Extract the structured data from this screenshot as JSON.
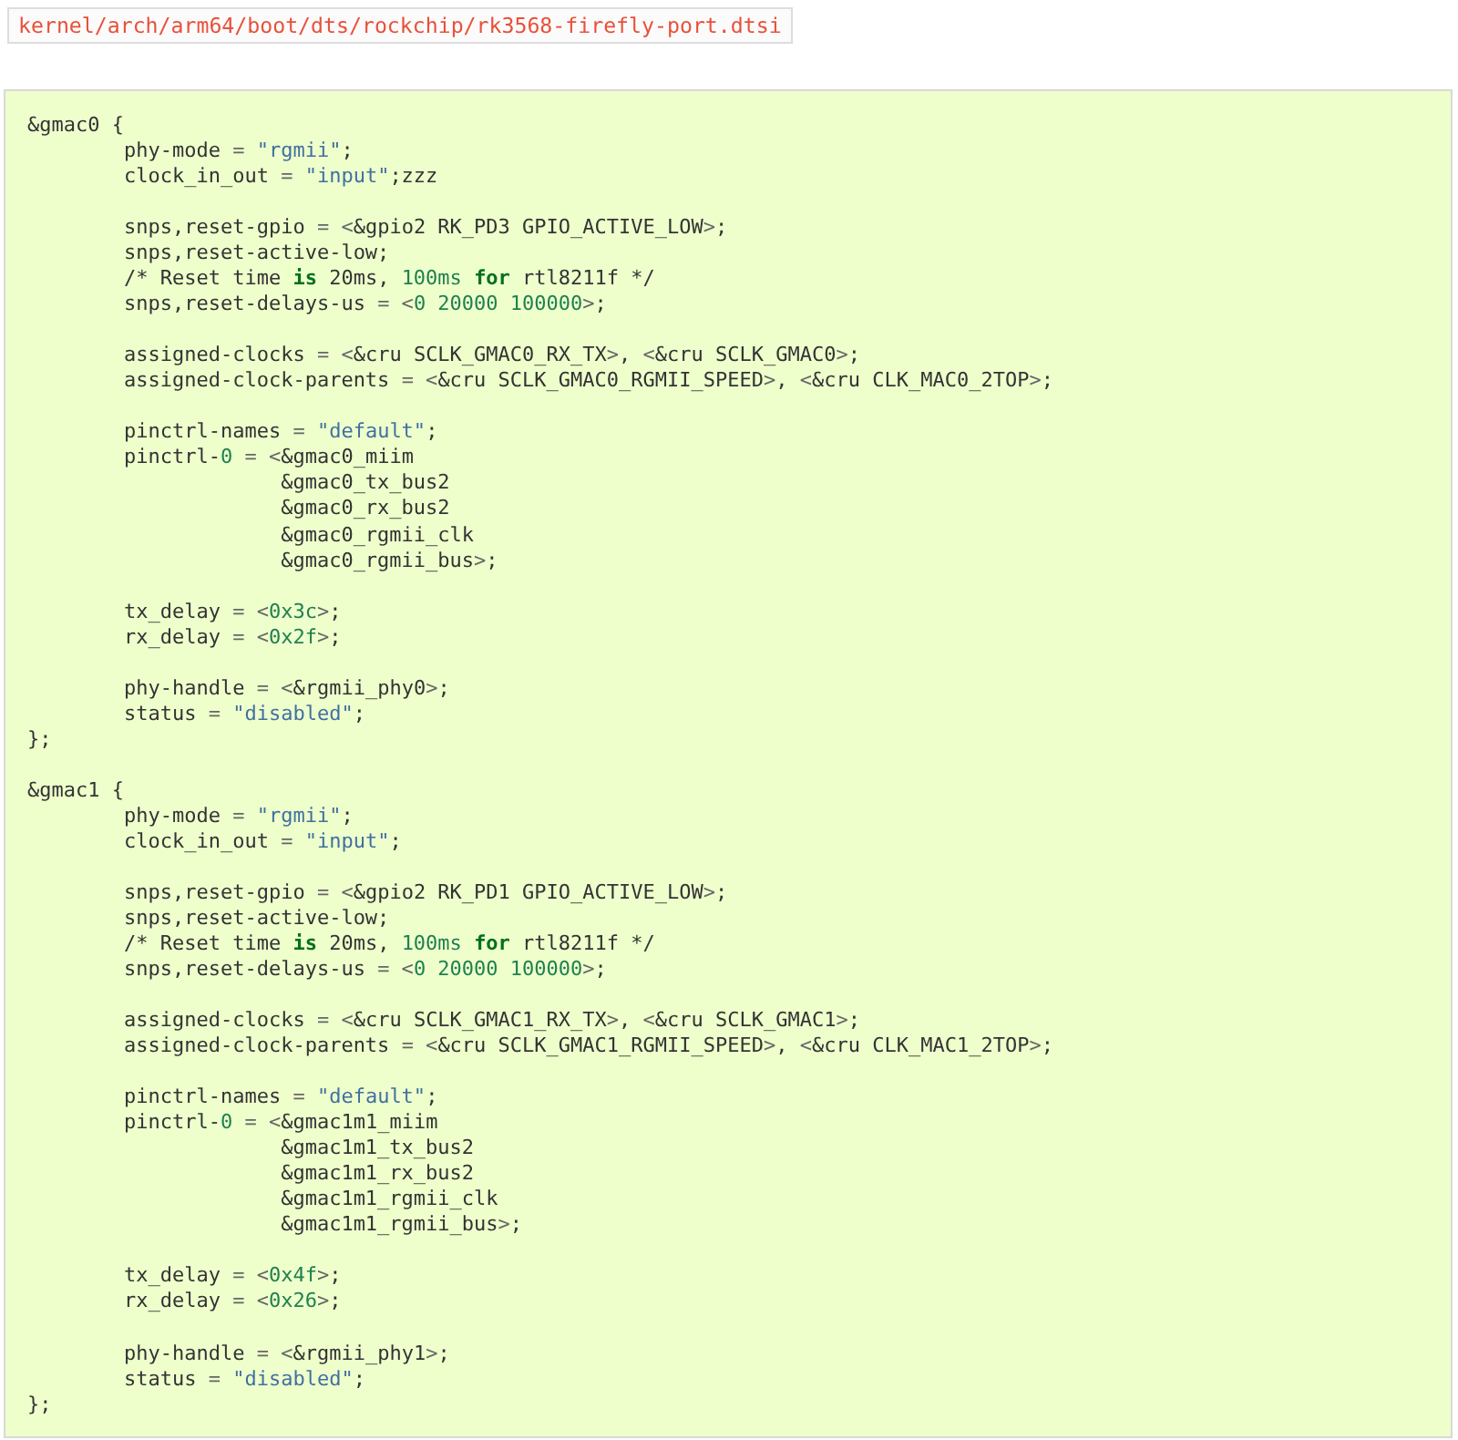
{
  "file_path": "kernel/arch/arm64/boot/dts/rockchip/rk3568-firefly-port.dtsi",
  "code": {
    "lines": [
      {
        "kind": "code",
        "tokens": [
          {
            "kind": "plain",
            "text": "&gmac0 {"
          }
        ]
      },
      {
        "kind": "code",
        "tokens": [
          {
            "kind": "plain",
            "text": "\tphy-mode "
          },
          {
            "kind": "op",
            "text": "= "
          },
          {
            "kind": "string",
            "text": "\"rgmii\""
          },
          {
            "kind": "plain",
            "text": ";"
          }
        ]
      },
      {
        "kind": "code",
        "tokens": [
          {
            "kind": "plain",
            "text": "\tclock_in_out "
          },
          {
            "kind": "op",
            "text": "= "
          },
          {
            "kind": "string",
            "text": "\"input\""
          },
          {
            "kind": "plain",
            "text": ";zzz"
          }
        ]
      },
      {
        "kind": "blank"
      },
      {
        "kind": "code",
        "tokens": [
          {
            "kind": "plain",
            "text": "\tsnps,reset-gpio "
          },
          {
            "kind": "op",
            "text": "= <"
          },
          {
            "kind": "plain",
            "text": "&gpio2 RK_PD3 GPIO_ACTIVE_LOW"
          },
          {
            "kind": "op",
            "text": ">"
          },
          {
            "kind": "plain",
            "text": ";"
          }
        ]
      },
      {
        "kind": "code",
        "tokens": [
          {
            "kind": "plain",
            "text": "\tsnps,reset-active-low;"
          }
        ]
      },
      {
        "kind": "code",
        "tokens": [
          {
            "kind": "plain",
            "text": "\t/* Reset time "
          },
          {
            "kind": "keyword",
            "text": "is"
          },
          {
            "kind": "plain",
            "text": " 20ms, "
          },
          {
            "kind": "number",
            "text": "100ms "
          },
          {
            "kind": "keyword",
            "text": "for"
          },
          {
            "kind": "plain",
            "text": " rtl8211f */"
          }
        ]
      },
      {
        "kind": "code",
        "tokens": [
          {
            "kind": "plain",
            "text": "\tsnps,reset-delays-us "
          },
          {
            "kind": "op",
            "text": "= <"
          },
          {
            "kind": "number",
            "text": "0 20000 100000"
          },
          {
            "kind": "op",
            "text": ">"
          },
          {
            "kind": "plain",
            "text": ";"
          }
        ]
      },
      {
        "kind": "blank"
      },
      {
        "kind": "code",
        "tokens": [
          {
            "kind": "plain",
            "text": "\tassigned-clocks "
          },
          {
            "kind": "op",
            "text": "= <"
          },
          {
            "kind": "plain",
            "text": "&cru SCLK_GMAC0_RX_TX"
          },
          {
            "kind": "op",
            "text": ">"
          },
          {
            "kind": "plain",
            "text": ", "
          },
          {
            "kind": "op",
            "text": "<"
          },
          {
            "kind": "plain",
            "text": "&cru SCLK_GMAC0"
          },
          {
            "kind": "op",
            "text": ">"
          },
          {
            "kind": "plain",
            "text": ";"
          }
        ]
      },
      {
        "kind": "code",
        "tokens": [
          {
            "kind": "plain",
            "text": "\tassigned-clock-parents "
          },
          {
            "kind": "op",
            "text": "= <"
          },
          {
            "kind": "plain",
            "text": "&cru SCLK_GMAC0_RGMII_SPEED"
          },
          {
            "kind": "op",
            "text": ">"
          },
          {
            "kind": "plain",
            "text": ", "
          },
          {
            "kind": "op",
            "text": "<"
          },
          {
            "kind": "plain",
            "text": "&cru CLK_MAC0_2TOP"
          },
          {
            "kind": "op",
            "text": ">"
          },
          {
            "kind": "plain",
            "text": ";"
          }
        ]
      },
      {
        "kind": "blank"
      },
      {
        "kind": "code",
        "tokens": [
          {
            "kind": "plain",
            "text": "\tpinctrl-names "
          },
          {
            "kind": "op",
            "text": "= "
          },
          {
            "kind": "string",
            "text": "\"default\""
          },
          {
            "kind": "plain",
            "text": ";"
          }
        ]
      },
      {
        "kind": "code",
        "tokens": [
          {
            "kind": "plain",
            "text": "\tpinctrl-"
          },
          {
            "kind": "number",
            "text": "0"
          },
          {
            "kind": "op",
            "text": " = <"
          },
          {
            "kind": "plain",
            "text": "&gmac0_miim"
          }
        ]
      },
      {
        "kind": "code",
        "tokens": [
          {
            "kind": "plain",
            "text": "\t             &gmac0_tx_bus2"
          }
        ]
      },
      {
        "kind": "code",
        "tokens": [
          {
            "kind": "plain",
            "text": "\t             &gmac0_rx_bus2"
          }
        ]
      },
      {
        "kind": "code",
        "tokens": [
          {
            "kind": "plain",
            "text": "\t             &gmac0_rgmii_clk"
          }
        ]
      },
      {
        "kind": "code",
        "tokens": [
          {
            "kind": "plain",
            "text": "\t             &gmac0_rgmii_bus"
          },
          {
            "kind": "op",
            "text": ">"
          },
          {
            "kind": "plain",
            "text": ";"
          }
        ]
      },
      {
        "kind": "blank"
      },
      {
        "kind": "code",
        "tokens": [
          {
            "kind": "plain",
            "text": "\ttx_delay "
          },
          {
            "kind": "op",
            "text": "= <"
          },
          {
            "kind": "number",
            "text": "0x3c"
          },
          {
            "kind": "op",
            "text": ">"
          },
          {
            "kind": "plain",
            "text": ";"
          }
        ]
      },
      {
        "kind": "code",
        "tokens": [
          {
            "kind": "plain",
            "text": "\trx_delay "
          },
          {
            "kind": "op",
            "text": "= <"
          },
          {
            "kind": "number",
            "text": "0x2f"
          },
          {
            "kind": "op",
            "text": ">"
          },
          {
            "kind": "plain",
            "text": ";"
          }
        ]
      },
      {
        "kind": "blank"
      },
      {
        "kind": "code",
        "tokens": [
          {
            "kind": "plain",
            "text": "\tphy-handle "
          },
          {
            "kind": "op",
            "text": "= <"
          },
          {
            "kind": "plain",
            "text": "&rgmii_phy0"
          },
          {
            "kind": "op",
            "text": ">"
          },
          {
            "kind": "plain",
            "text": ";"
          }
        ]
      },
      {
        "kind": "code",
        "tokens": [
          {
            "kind": "plain",
            "text": "\tstatus "
          },
          {
            "kind": "op",
            "text": "= "
          },
          {
            "kind": "string",
            "text": "\"disabled\""
          },
          {
            "kind": "plain",
            "text": ";"
          }
        ]
      },
      {
        "kind": "code",
        "tokens": [
          {
            "kind": "plain",
            "text": "};"
          }
        ]
      },
      {
        "kind": "blank"
      },
      {
        "kind": "code",
        "tokens": [
          {
            "kind": "plain",
            "text": "&gmac1 {"
          }
        ]
      },
      {
        "kind": "code",
        "tokens": [
          {
            "kind": "plain",
            "text": "\tphy-mode "
          },
          {
            "kind": "op",
            "text": "= "
          },
          {
            "kind": "string",
            "text": "\"rgmii\""
          },
          {
            "kind": "plain",
            "text": ";"
          }
        ]
      },
      {
        "kind": "code",
        "tokens": [
          {
            "kind": "plain",
            "text": "\tclock_in_out "
          },
          {
            "kind": "op",
            "text": "= "
          },
          {
            "kind": "string",
            "text": "\"input\""
          },
          {
            "kind": "plain",
            "text": ";"
          }
        ]
      },
      {
        "kind": "blank"
      },
      {
        "kind": "code",
        "tokens": [
          {
            "kind": "plain",
            "text": "\tsnps,reset-gpio "
          },
          {
            "kind": "op",
            "text": "= <"
          },
          {
            "kind": "plain",
            "text": "&gpio2 RK_PD1 GPIO_ACTIVE_LOW"
          },
          {
            "kind": "op",
            "text": ">"
          },
          {
            "kind": "plain",
            "text": ";"
          }
        ]
      },
      {
        "kind": "code",
        "tokens": [
          {
            "kind": "plain",
            "text": "\tsnps,reset-active-low;"
          }
        ]
      },
      {
        "kind": "code",
        "tokens": [
          {
            "kind": "plain",
            "text": "\t/* Reset time "
          },
          {
            "kind": "keyword",
            "text": "is"
          },
          {
            "kind": "plain",
            "text": " 20ms, "
          },
          {
            "kind": "number",
            "text": "100ms "
          },
          {
            "kind": "keyword",
            "text": "for"
          },
          {
            "kind": "plain",
            "text": " rtl8211f */"
          }
        ]
      },
      {
        "kind": "code",
        "tokens": [
          {
            "kind": "plain",
            "text": "\tsnps,reset-delays-us "
          },
          {
            "kind": "op",
            "text": "= <"
          },
          {
            "kind": "number",
            "text": "0 20000 100000"
          },
          {
            "kind": "op",
            "text": ">"
          },
          {
            "kind": "plain",
            "text": ";"
          }
        ]
      },
      {
        "kind": "blank"
      },
      {
        "kind": "code",
        "tokens": [
          {
            "kind": "plain",
            "text": "\tassigned-clocks "
          },
          {
            "kind": "op",
            "text": "= <"
          },
          {
            "kind": "plain",
            "text": "&cru SCLK_GMAC1_RX_TX"
          },
          {
            "kind": "op",
            "text": ">"
          },
          {
            "kind": "plain",
            "text": ", "
          },
          {
            "kind": "op",
            "text": "<"
          },
          {
            "kind": "plain",
            "text": "&cru SCLK_GMAC1"
          },
          {
            "kind": "op",
            "text": ">"
          },
          {
            "kind": "plain",
            "text": ";"
          }
        ]
      },
      {
        "kind": "code",
        "tokens": [
          {
            "kind": "plain",
            "text": "\tassigned-clock-parents "
          },
          {
            "kind": "op",
            "text": "= <"
          },
          {
            "kind": "plain",
            "text": "&cru SCLK_GMAC1_RGMII_SPEED"
          },
          {
            "kind": "op",
            "text": ">"
          },
          {
            "kind": "plain",
            "text": ", "
          },
          {
            "kind": "op",
            "text": "<"
          },
          {
            "kind": "plain",
            "text": "&cru CLK_MAC1_2TOP"
          },
          {
            "kind": "op",
            "text": ">"
          },
          {
            "kind": "plain",
            "text": ";"
          }
        ]
      },
      {
        "kind": "blank"
      },
      {
        "kind": "code",
        "tokens": [
          {
            "kind": "plain",
            "text": "\tpinctrl-names "
          },
          {
            "kind": "op",
            "text": "= "
          },
          {
            "kind": "string",
            "text": "\"default\""
          },
          {
            "kind": "plain",
            "text": ";"
          }
        ]
      },
      {
        "kind": "code",
        "tokens": [
          {
            "kind": "plain",
            "text": "\tpinctrl-"
          },
          {
            "kind": "number",
            "text": "0"
          },
          {
            "kind": "op",
            "text": " = <"
          },
          {
            "kind": "plain",
            "text": "&gmac1m1_miim"
          }
        ]
      },
      {
        "kind": "code",
        "tokens": [
          {
            "kind": "plain",
            "text": "\t             &gmac1m1_tx_bus2"
          }
        ]
      },
      {
        "kind": "code",
        "tokens": [
          {
            "kind": "plain",
            "text": "\t             &gmac1m1_rx_bus2"
          }
        ]
      },
      {
        "kind": "code",
        "tokens": [
          {
            "kind": "plain",
            "text": "\t             &gmac1m1_rgmii_clk"
          }
        ]
      },
      {
        "kind": "code",
        "tokens": [
          {
            "kind": "plain",
            "text": "\t             &gmac1m1_rgmii_bus"
          },
          {
            "kind": "op",
            "text": ">"
          },
          {
            "kind": "plain",
            "text": ";"
          }
        ]
      },
      {
        "kind": "blank"
      },
      {
        "kind": "code",
        "tokens": [
          {
            "kind": "plain",
            "text": "\ttx_delay "
          },
          {
            "kind": "op",
            "text": "= <"
          },
          {
            "kind": "number",
            "text": "0x4f"
          },
          {
            "kind": "op",
            "text": ">"
          },
          {
            "kind": "plain",
            "text": ";"
          }
        ]
      },
      {
        "kind": "code",
        "tokens": [
          {
            "kind": "plain",
            "text": "\trx_delay "
          },
          {
            "kind": "op",
            "text": "= <"
          },
          {
            "kind": "number",
            "text": "0x26"
          },
          {
            "kind": "op",
            "text": ">"
          },
          {
            "kind": "plain",
            "text": ";"
          }
        ]
      },
      {
        "kind": "blank"
      },
      {
        "kind": "code",
        "tokens": [
          {
            "kind": "plain",
            "text": "\tphy-handle "
          },
          {
            "kind": "op",
            "text": "= <"
          },
          {
            "kind": "plain",
            "text": "&rgmii_phy1"
          },
          {
            "kind": "op",
            "text": ">"
          },
          {
            "kind": "plain",
            "text": ";"
          }
        ]
      },
      {
        "kind": "code",
        "tokens": [
          {
            "kind": "plain",
            "text": "\tstatus "
          },
          {
            "kind": "op",
            "text": "= "
          },
          {
            "kind": "string",
            "text": "\"disabled\""
          },
          {
            "kind": "plain",
            "text": ";"
          }
        ]
      },
      {
        "kind": "code",
        "tokens": [
          {
            "kind": "plain",
            "text": "};"
          }
        ]
      }
    ]
  }
}
